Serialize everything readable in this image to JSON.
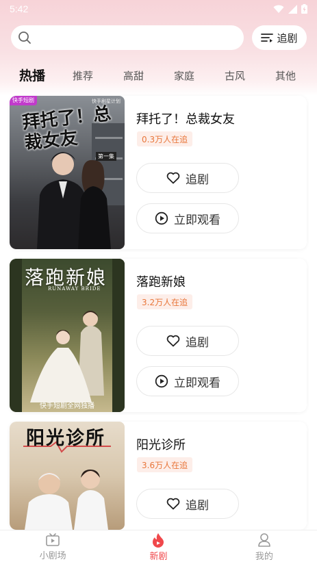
{
  "status_bar": {
    "time": "5:42"
  },
  "header": {
    "follow_label": "追剧"
  },
  "tabs": [
    {
      "label": "热播",
      "active": true
    },
    {
      "label": "推荐",
      "active": false
    },
    {
      "label": "高甜",
      "active": false
    },
    {
      "label": "家庭",
      "active": false
    },
    {
      "label": "古风",
      "active": false
    },
    {
      "label": "其他",
      "active": false
    }
  ],
  "dramas": [
    {
      "title": "拜托了！总裁女友",
      "followers": "0.3万人在追",
      "follow_label": "追剧",
      "watch_label": "立即观看",
      "poster_title": "拜托了！总裁女友",
      "poster_tag": "快手短剧",
      "poster_corner": "快手剧星计划",
      "poster_episode": "第一集"
    },
    {
      "title": "落跑新娘",
      "followers": "3.2万人在追",
      "follow_label": "追剧",
      "watch_label": "立即观看",
      "poster_title": "落跑新娘",
      "poster_subtitle": "RUNAWAY BRIDE",
      "poster_footer": "快手短剧全网独播"
    },
    {
      "title": "阳光诊所",
      "followers": "3.6万人在追",
      "follow_label": "追剧",
      "poster_title": "阳光诊所"
    }
  ],
  "bottom_nav": [
    {
      "label": "小剧场",
      "icon": "tv-icon",
      "active": false
    },
    {
      "label": "新剧",
      "icon": "flame-icon",
      "active": true
    },
    {
      "label": "我的",
      "icon": "person-icon",
      "active": false
    }
  ],
  "colors": {
    "accent": "#f0484b",
    "badge_text": "#e8763a",
    "badge_bg": "#fdeee9"
  }
}
